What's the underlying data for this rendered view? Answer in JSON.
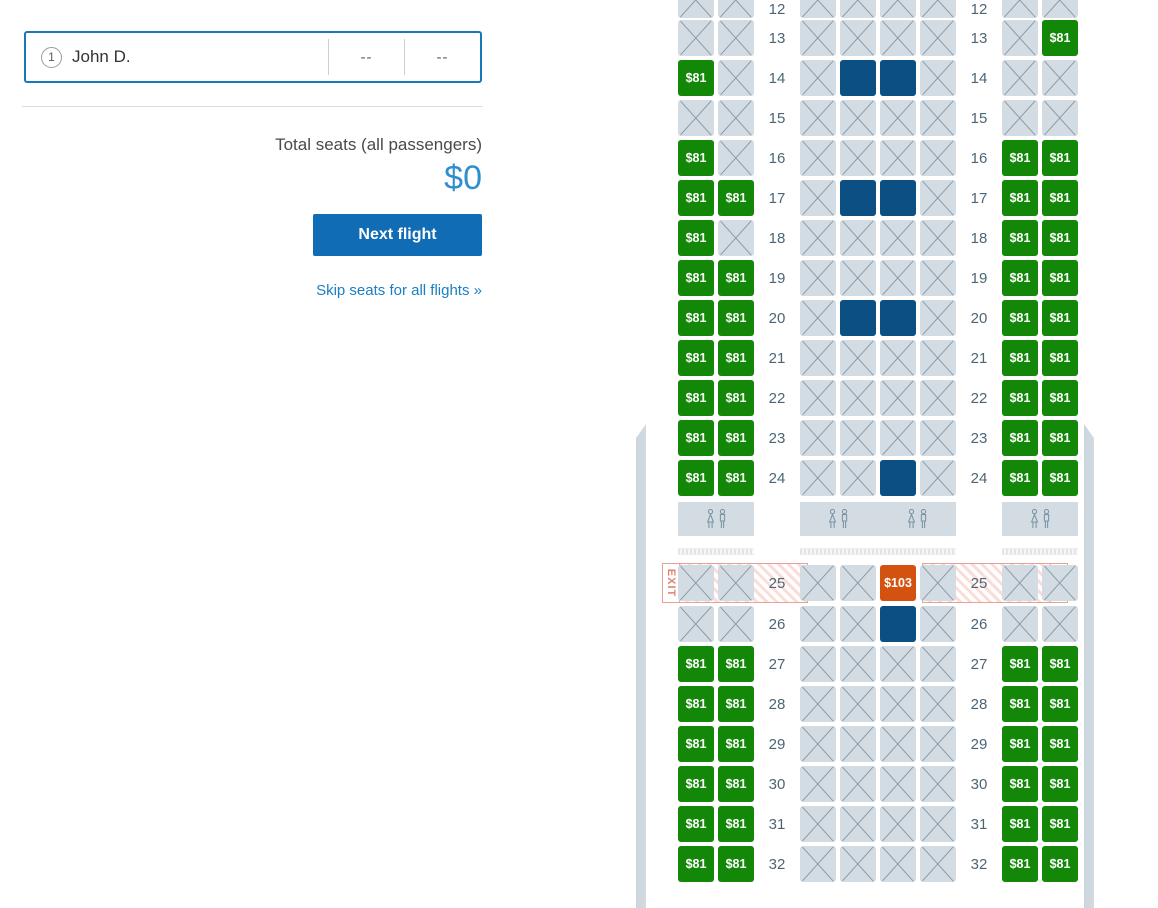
{
  "left_panel": {
    "passenger": {
      "number": "1",
      "name": "John D.",
      "col2": "--",
      "col3": "--"
    },
    "totals_label": "Total seats (all passengers)",
    "totals_value": "$0",
    "next_button": "Next flight",
    "skip_link": "Skip seats for all flights »"
  },
  "seatmap": {
    "exit_label": "EXIT",
    "colors": {
      "available": "#138808",
      "premium": "#d4520f",
      "occupied": "#0c4f82",
      "unavailable": "#d3dce3",
      "exit_accent": "#e08070",
      "rownum": "#4c6575"
    },
    "prices": {
      "standard": "$81",
      "exit_premium": "$103"
    },
    "rows": [
      {
        "num": "12",
        "partial": true,
        "left": [
          "unavailable",
          "unavailable"
        ],
        "center": [
          "unavailable",
          "unavailable",
          "unavailable",
          "unavailable"
        ],
        "right": [
          "unavailable",
          "unavailable"
        ]
      },
      {
        "num": "13",
        "left": [
          "unavailable",
          "unavailable"
        ],
        "center": [
          "unavailable",
          "unavailable",
          "unavailable",
          "unavailable"
        ],
        "right": [
          "unavailable",
          "available"
        ]
      },
      {
        "num": "14",
        "left": [
          "available",
          "unavailable"
        ],
        "center": [
          "unavailable",
          "occupied",
          "occupied",
          "unavailable"
        ],
        "right": [
          "unavailable",
          "unavailable"
        ]
      },
      {
        "num": "15",
        "left": [
          "unavailable",
          "unavailable"
        ],
        "center": [
          "unavailable",
          "unavailable",
          "unavailable",
          "unavailable"
        ],
        "right": [
          "unavailable",
          "unavailable"
        ]
      },
      {
        "num": "16",
        "left": [
          "available",
          "unavailable"
        ],
        "center": [
          "unavailable",
          "unavailable",
          "unavailable",
          "unavailable"
        ],
        "right": [
          "available",
          "available"
        ]
      },
      {
        "num": "17",
        "left": [
          "available",
          "available"
        ],
        "center": [
          "unavailable",
          "occupied",
          "occupied",
          "unavailable"
        ],
        "right": [
          "available",
          "available"
        ]
      },
      {
        "num": "18",
        "left": [
          "available",
          "unavailable"
        ],
        "center": [
          "unavailable",
          "unavailable",
          "unavailable",
          "unavailable"
        ],
        "right": [
          "available",
          "available"
        ]
      },
      {
        "num": "19",
        "left": [
          "available",
          "available"
        ],
        "center": [
          "unavailable",
          "unavailable",
          "unavailable",
          "unavailable"
        ],
        "right": [
          "available",
          "available"
        ]
      },
      {
        "num": "20",
        "left": [
          "available",
          "available"
        ],
        "center": [
          "unavailable",
          "occupied",
          "occupied",
          "unavailable"
        ],
        "right": [
          "available",
          "available"
        ]
      },
      {
        "num": "21",
        "left": [
          "available",
          "available"
        ],
        "center": [
          "unavailable",
          "unavailable",
          "unavailable",
          "unavailable"
        ],
        "right": [
          "available",
          "available"
        ]
      },
      {
        "num": "22",
        "left": [
          "available",
          "available"
        ],
        "center": [
          "unavailable",
          "unavailable",
          "unavailable",
          "unavailable"
        ],
        "right": [
          "available",
          "available"
        ]
      },
      {
        "num": "23",
        "left": [
          "available",
          "available"
        ],
        "center": [
          "unavailable",
          "unavailable",
          "unavailable",
          "unavailable"
        ],
        "right": [
          "available",
          "available"
        ]
      },
      {
        "num": "24",
        "left": [
          "available",
          "available"
        ],
        "center": [
          "unavailable",
          "unavailable",
          "occupied",
          "unavailable"
        ],
        "right": [
          "available",
          "available"
        ]
      }
    ],
    "rows_after_exit": [
      {
        "num": "26",
        "left": [
          "unavailable",
          "unavailable"
        ],
        "center": [
          "unavailable",
          "unavailable",
          "occupied",
          "unavailable"
        ],
        "right": [
          "unavailable",
          "unavailable"
        ]
      },
      {
        "num": "27",
        "left": [
          "available",
          "available"
        ],
        "center": [
          "unavailable",
          "unavailable",
          "unavailable",
          "unavailable"
        ],
        "right": [
          "available",
          "available"
        ]
      },
      {
        "num": "28",
        "left": [
          "available",
          "available"
        ],
        "center": [
          "unavailable",
          "unavailable",
          "unavailable",
          "unavailable"
        ],
        "right": [
          "available",
          "available"
        ]
      },
      {
        "num": "29",
        "left": [
          "available",
          "available"
        ],
        "center": [
          "unavailable",
          "unavailable",
          "unavailable",
          "unavailable"
        ],
        "right": [
          "available",
          "available"
        ]
      },
      {
        "num": "30",
        "left": [
          "available",
          "available"
        ],
        "center": [
          "unavailable",
          "unavailable",
          "unavailable",
          "unavailable"
        ],
        "right": [
          "available",
          "available"
        ]
      },
      {
        "num": "31",
        "left": [
          "available",
          "available"
        ],
        "center": [
          "unavailable",
          "unavailable",
          "unavailable",
          "unavailable"
        ],
        "right": [
          "available",
          "available"
        ]
      },
      {
        "num": "32",
        "left": [
          "available",
          "available"
        ],
        "center": [
          "unavailable",
          "unavailable",
          "unavailable",
          "unavailable"
        ],
        "right": [
          "available",
          "available"
        ]
      }
    ],
    "exit_row": {
      "num": "25",
      "left": [
        "unavailable",
        "unavailable"
      ],
      "center": [
        "unavailable",
        "unavailable",
        "premium",
        "unavailable"
      ],
      "right": [
        "unavailable",
        "unavailable"
      ]
    },
    "lavatory_icon": "lavatory-icon"
  }
}
